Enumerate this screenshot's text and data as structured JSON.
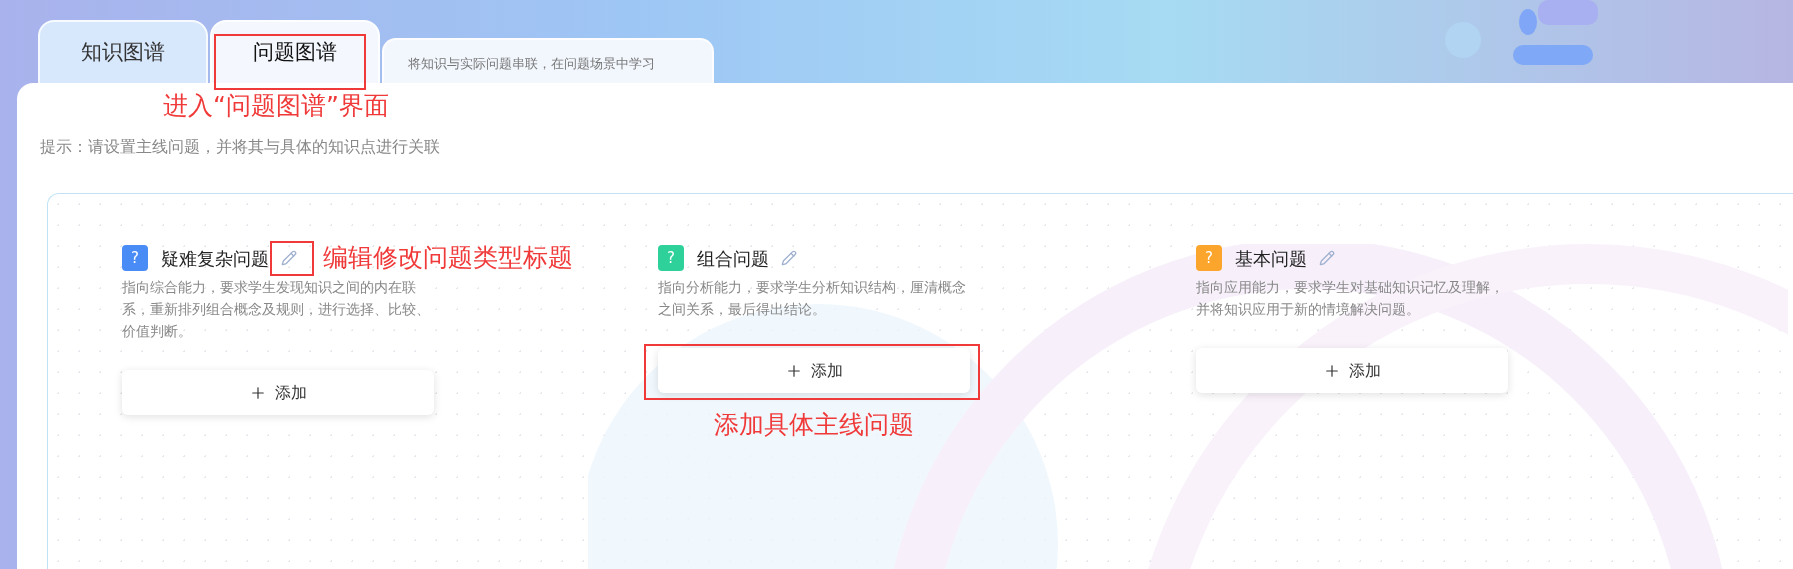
{
  "tabs": [
    {
      "label": "知识图谱",
      "selected": false
    },
    {
      "label": "问题图谱",
      "selected": true,
      "annotation": "进入“问题图谱”界面"
    }
  ],
  "tab_caption": "将知识与实际问题串联，在问题场景中学习",
  "hint": "提示：请设置主线问题，并将其与具体的知识点进行关联",
  "categories": [
    {
      "icon_text": "?",
      "color": "#4a8cf6",
      "title": "疑难复杂问题",
      "description": "指向综合能力，要求学生发现知识之间的内在联系，重新排列组合概念及规则，进行选择、比较、价值判断。",
      "add_button": "添加",
      "edit_annotation": "编辑修改问题类型标题"
    },
    {
      "icon_text": "?",
      "color": "#2fd19a",
      "title": "组合问题",
      "description": "指向分析能力，要求学生分析知识结构，厘清概念之间关系，最后得出结论。",
      "add_button": "添加",
      "add_annotation": "添加具体主线问题"
    },
    {
      "icon_text": "?",
      "color": "#fba52c",
      "title": "基本问题",
      "description": "指向应用能力，要求学生对基础知识记忆及理解，并将知识应用于新的情境解决问题。",
      "add_button": "添加"
    }
  ]
}
